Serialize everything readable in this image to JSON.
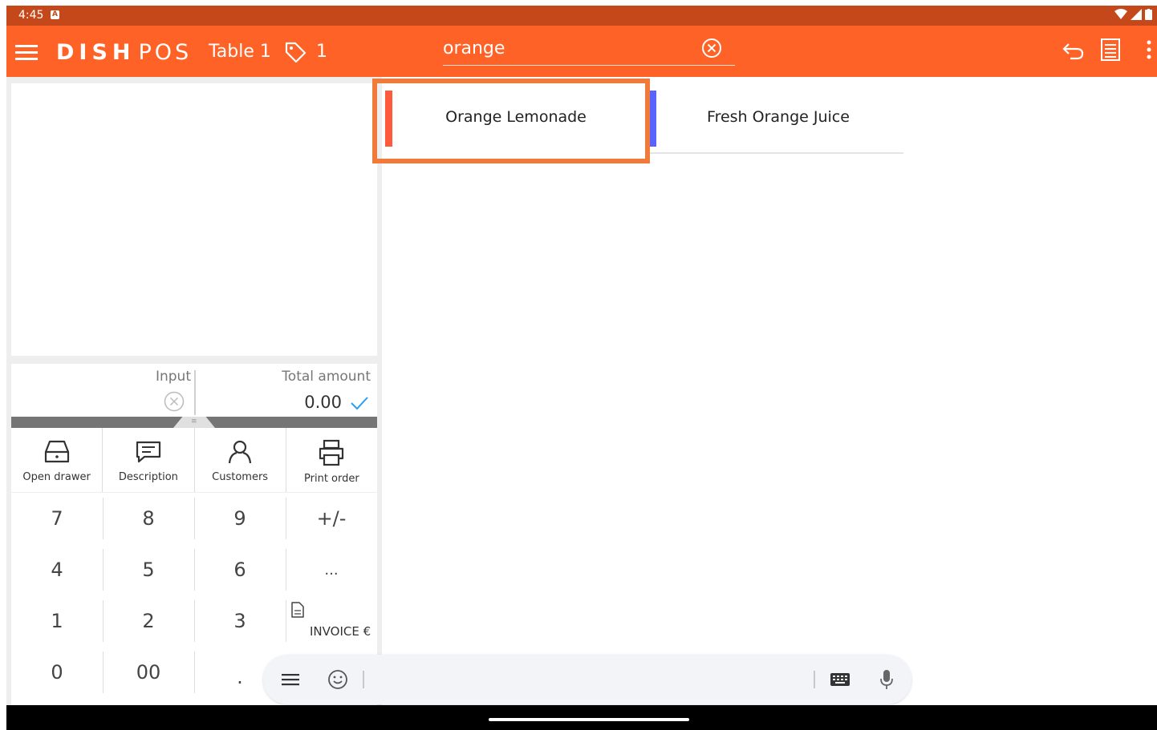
{
  "status": {
    "time": "4:45"
  },
  "appbar": {
    "brand_bold": "DISH",
    "brand_light": "POS",
    "table": "Table 1",
    "guests": "1",
    "search_value": "orange"
  },
  "products": [
    {
      "name": "Orange Lemonade",
      "color": "#ff5a3c"
    },
    {
      "name": "Fresh Orange Juice",
      "color": "#5764ff"
    }
  ],
  "io": {
    "input_label": "Input",
    "total_label": "Total amount",
    "total_value": "0.00"
  },
  "actions": [
    {
      "label": "Open drawer",
      "icon": "drawer-icon"
    },
    {
      "label": "Description",
      "icon": "message-icon"
    },
    {
      "label": "Customers",
      "icon": "person-icon"
    },
    {
      "label": "Print order",
      "icon": "printer-icon"
    }
  ],
  "keypad": {
    "k7": "7",
    "k8": "8",
    "k9": "9",
    "plusminus": "+/-",
    "k4": "4",
    "k5": "5",
    "k6": "6",
    "more": "...",
    "k1": "1",
    "k2": "2",
    "k3": "3",
    "invoice": "INVOICE  €",
    "k0": "0",
    "k00": "00",
    "dot": "."
  }
}
